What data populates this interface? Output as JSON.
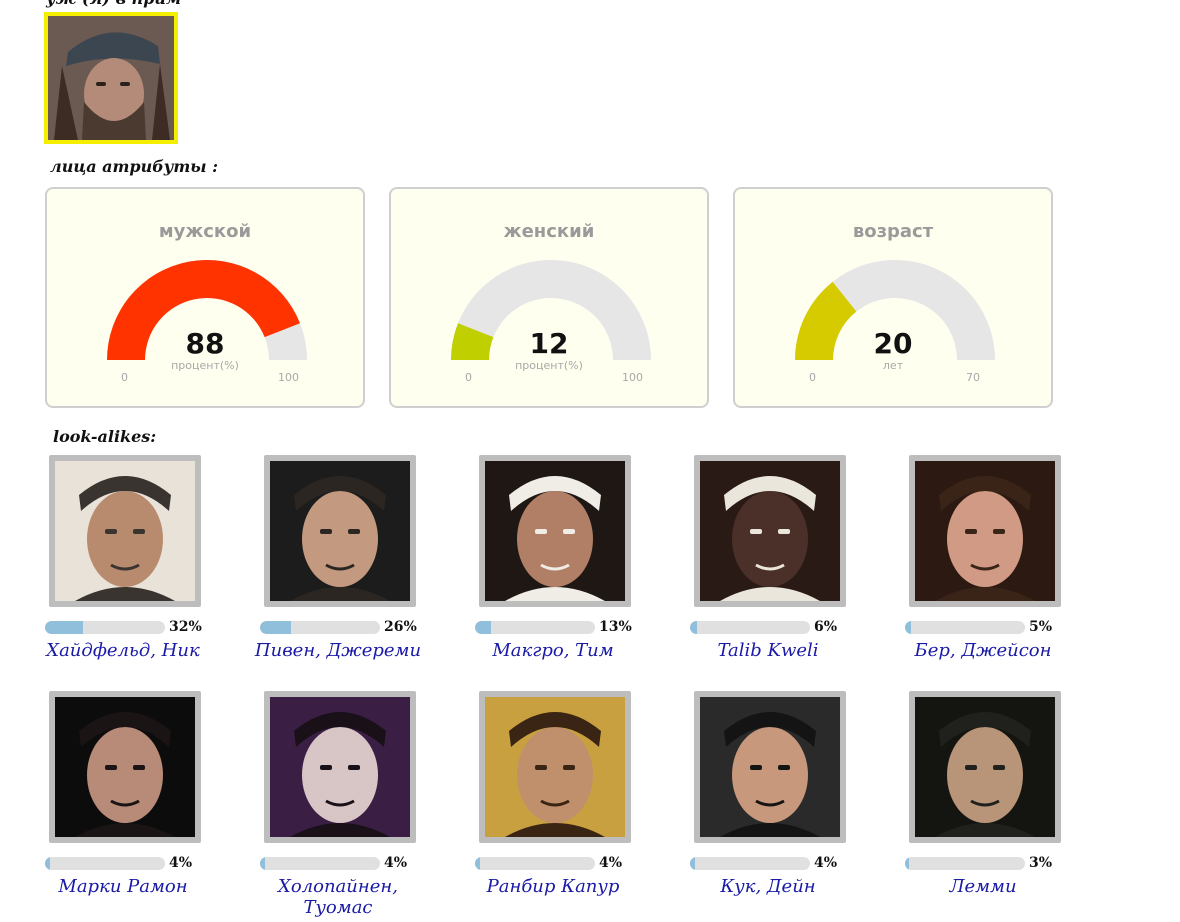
{
  "header": {
    "cut_text": "уж (я) в прим"
  },
  "sections": {
    "face_attributes": "лица атрибуты :",
    "look_alikes": "look-alikes:"
  },
  "gauges": [
    {
      "title": "мужской",
      "value": "88",
      "unit": "процент(%)",
      "min": "0",
      "max": "100",
      "level": 0.88,
      "color": "#ff3300"
    },
    {
      "title": "женский",
      "value": "12",
      "unit": "процент(%)",
      "min": "0",
      "max": "100",
      "level": 0.12,
      "color": "#bfcf00"
    },
    {
      "title": "возраст",
      "value": "20",
      "unit": "лет",
      "min": "0",
      "max": "70",
      "level": 0.2857,
      "color": "#d6cb00"
    }
  ],
  "look_alikes": [
    {
      "name": "Хайдфельд, Ник",
      "percent": "32%",
      "level": 0.32,
      "photo_colors": [
        "#e9e2d8",
        "#b98b6e",
        "#3a3430"
      ]
    },
    {
      "name": "Пивен, Джереми",
      "percent": "26%",
      "level": 0.26,
      "photo_colors": [
        "#1c1c1c",
        "#c39a80",
        "#2c2622"
      ]
    },
    {
      "name": "Макгро, Тим",
      "percent": "13%",
      "level": 0.13,
      "photo_colors": [
        "#1e1714",
        "#b07f66",
        "#f0ece6"
      ]
    },
    {
      "name": "Talib Kweli",
      "percent": "6%",
      "level": 0.06,
      "photo_colors": [
        "#2a1a16",
        "#4a3028",
        "#ebe6dc"
      ]
    },
    {
      "name": "Бер, Джейсон",
      "percent": "5%",
      "level": 0.05,
      "photo_colors": [
        "#2c1a12",
        "#d09a84",
        "#3a2418"
      ]
    },
    {
      "name": "Марки Рамон",
      "percent": "4%",
      "level": 0.04,
      "photo_colors": [
        "#0c0c0c",
        "#b88a78",
        "#1a1414"
      ]
    },
    {
      "name": "Холопайнен, Туомас",
      "percent": "4%",
      "level": 0.04,
      "photo_colors": [
        "#3a1e44",
        "#d8c6c6",
        "#1a1018"
      ]
    },
    {
      "name": "Ранбир Капур",
      "percent": "4%",
      "level": 0.04,
      "photo_colors": [
        "#c8a040",
        "#c0906c",
        "#3a2414"
      ]
    },
    {
      "name": "Кук, Дейн",
      "percent": "4%",
      "level": 0.04,
      "photo_colors": [
        "#2a2a2a",
        "#c8987c",
        "#141414"
      ]
    },
    {
      "name": "Лемми",
      "percent": "3%",
      "level": 0.03,
      "photo_colors": [
        "#141410",
        "#b89478",
        "#20201c"
      ]
    }
  ]
}
